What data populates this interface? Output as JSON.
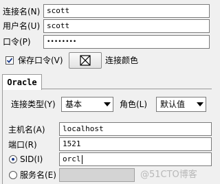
{
  "connection": {
    "name_label": "连接名(N)",
    "name_value": "scott",
    "user_label": "用户名(U)",
    "user_value": "scott",
    "password_label": "口令(P)",
    "password_value": "••••••••",
    "save_password_label": "保存口令(V)",
    "save_password_checked": true,
    "color_label": "连接颜色"
  },
  "tabs": [
    {
      "label": "Oracle",
      "active": true
    }
  ],
  "oracle": {
    "conn_type_label": "连接类型(Y)",
    "conn_type_value": "基本",
    "role_label": "角色(L)",
    "role_value": "默认值",
    "host_label": "主机名(A)",
    "host_value": "localhost",
    "port_label": "端口(R)",
    "port_value": "1521",
    "sid_label": "SID(I)",
    "sid_value": "orcl",
    "sid_selected": true,
    "service_label": "服务名(E)",
    "service_value": ""
  },
  "watermark": "@51CTO博客"
}
